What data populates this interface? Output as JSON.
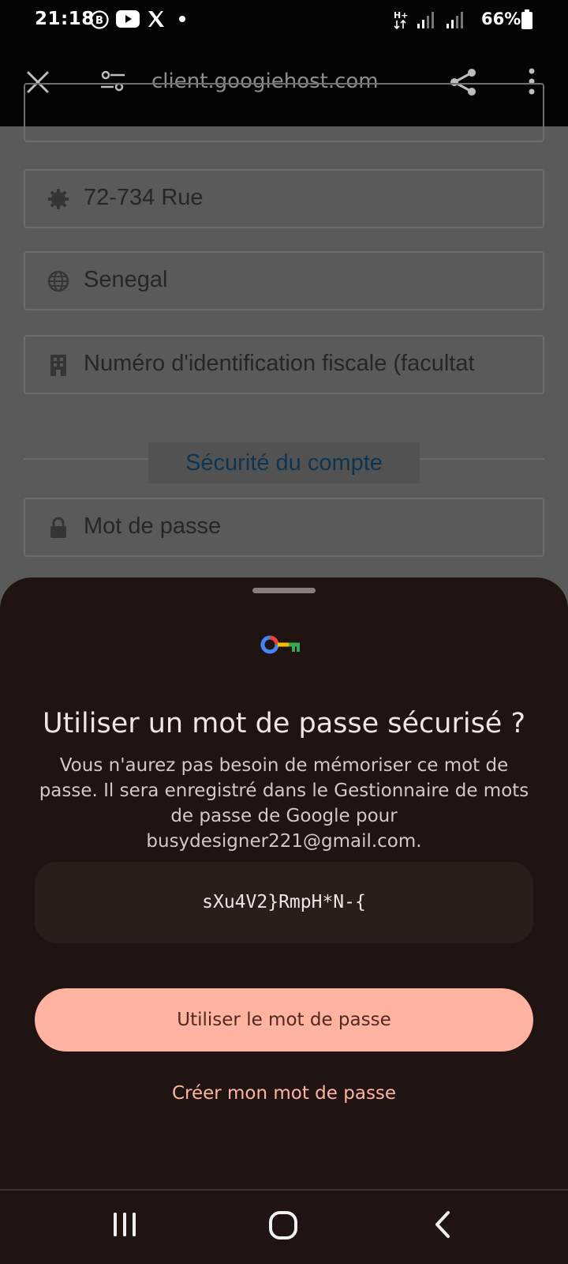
{
  "status_bar": {
    "time": "21:18",
    "battery": "66%",
    "icons": [
      "business-icon",
      "youtube-icon",
      "x-icon",
      "dot-icon",
      "network-hplus-icon",
      "signal-icon",
      "signal-icon",
      "battery-icon"
    ]
  },
  "browser": {
    "url": "client.googiehost.com",
    "close_icon": "close-icon",
    "site_settings_icon": "tune-icon",
    "share_icon": "share-icon",
    "menu_icon": "more-vert-icon"
  },
  "page": {
    "fields": [
      {
        "icon": "gear-icon",
        "value": "72-734 Rue"
      },
      {
        "icon": "globe-icon",
        "value": "Senegal"
      },
      {
        "icon": "building-icon",
        "placeholder": "Numéro d'identification fiscale (facultat"
      },
      {
        "icon": "lock-icon",
        "placeholder": "Mot de passe"
      }
    ],
    "section_title": "Sécurité du compte"
  },
  "sheet": {
    "title": "Utiliser un mot de passe sécurisé ?",
    "description": "Vous n'aurez pas besoin de mémoriser ce mot de passe. Il sera enregistré dans le Gestionnaire de mots de passe de Google pour busydesigner221@gmail.com.",
    "suggested_password": "sXu4V2}RmpH*N-{",
    "use_button": "Utiliser le mot de passe",
    "create_link": "Créer mon mot de passe"
  },
  "colors": {
    "sheet_bg": "#1f1412",
    "accent": "#ffb3a0",
    "toolbar_bg": "#050404"
  }
}
